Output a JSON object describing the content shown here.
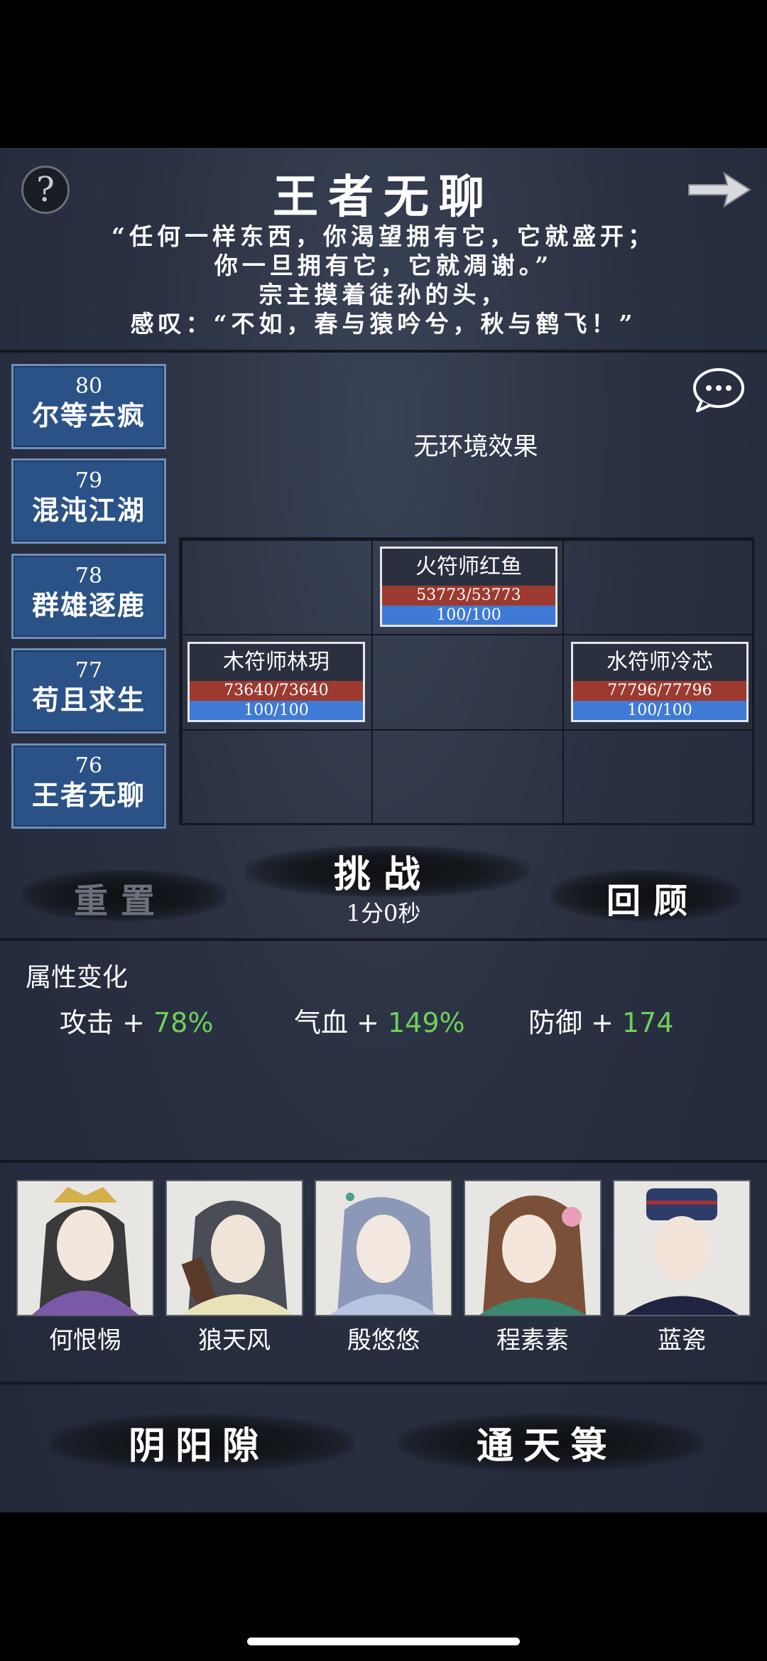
{
  "header": {
    "title": "王者无聊",
    "help_label": "?",
    "quote_lines": [
      "“任何一样东西，你渴望拥有它，它就盛开；",
      "你一旦拥有它，它就凋谢。”",
      "宗主摸着徒孙的头，",
      "感叹：“不如，春与猿吟兮，秋与鹤飞！”"
    ]
  },
  "levels": [
    {
      "num": "80",
      "name": "尔等去疯"
    },
    {
      "num": "79",
      "name": "混沌江湖"
    },
    {
      "num": "78",
      "name": "群雄逐鹿"
    },
    {
      "num": "77",
      "name": "苟且求生"
    },
    {
      "num": "76",
      "name": "王者无聊"
    }
  ],
  "environment": "无环境效果",
  "units": [
    {
      "name": "火符师红鱼",
      "hp": "53773/53773",
      "mp": "100/100"
    },
    {
      "name": "木符师林玥",
      "hp": "73640/73640",
      "mp": "100/100"
    },
    {
      "name": "水符师冷芯",
      "hp": "77796/77796",
      "mp": "100/100"
    }
  ],
  "actions": {
    "reset": "重置",
    "challenge": "挑战",
    "timer": "1分0秒",
    "review": "回顾"
  },
  "attributes": {
    "title": "属性变化",
    "items": [
      {
        "label": "攻击 + ",
        "value": "78%"
      },
      {
        "label": "气血 + ",
        "value": "149%"
      },
      {
        "label": "防御 + ",
        "value": "174"
      }
    ]
  },
  "characters": [
    {
      "name": "何恨惕"
    },
    {
      "name": "狼天风"
    },
    {
      "name": "殷悠悠"
    },
    {
      "name": "程素素"
    },
    {
      "name": "蓝瓷"
    }
  ],
  "bottom": {
    "left": "阴阳隙",
    "right": "通天箓"
  },
  "colors": {
    "level_bg": "#2b5286",
    "hp_bar": "#9c3a30",
    "mp_bar": "#3e7ad6",
    "positive": "#6fcf5b"
  }
}
